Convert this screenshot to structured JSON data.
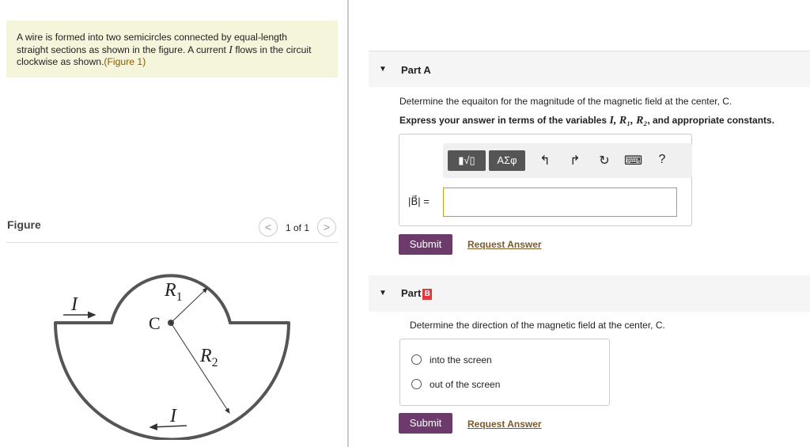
{
  "problem": {
    "line1": "A wire is formed into two semicircles connected by equal-length",
    "line2_a": "straight sections as shown in the figure. A current ",
    "current_symbol": "I",
    "line2_b": " flows in the circuit",
    "line3": "clockwise as shown.",
    "figure_link": "(Figure 1)"
  },
  "figure_panel": {
    "label": "Figure",
    "prev": "<",
    "next": ">",
    "pager": "1 of 1",
    "labels": {
      "current_top": "I",
      "current_bottom": "I",
      "center": "C",
      "r1": "R",
      "r1_sub": "1",
      "r2": "R",
      "r2_sub": "2"
    }
  },
  "partA": {
    "title": "Part A",
    "question": "Determine the equaiton for the magnitude of the magnetic field at the center, C.",
    "instruction_a": "Express your answer in terms of the variables ",
    "vars": "I, R₁, R₂",
    "instruction_b": ", and appropriate constants.",
    "toolbar": {
      "templates": "▮√▯",
      "greek": "ΑΣφ",
      "undo": "↰",
      "redo": "↱",
      "reset": "↻",
      "keyboard": "⌨",
      "help": "?"
    },
    "answer_label": "|B⃗| =",
    "answer_value": "",
    "submit": "Submit",
    "request": "Request Answer"
  },
  "partB": {
    "title": "Part",
    "title_mark": "B",
    "question": "Determine the direction of the magnetic field at the center, C.",
    "options": [
      "into the screen",
      "out of the screen"
    ],
    "submit": "Submit",
    "request": "Request Answer"
  },
  "colors": {
    "submit": "#6d3b6b",
    "problem_bg": "#f5f5dc",
    "link": "#8a5a00",
    "input_border": "#c9a200"
  }
}
